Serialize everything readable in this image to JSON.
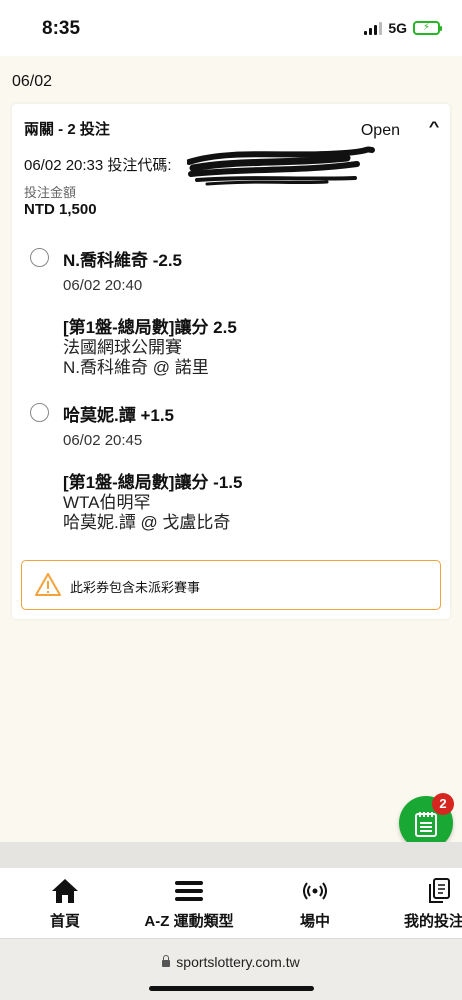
{
  "status_bar": {
    "time": "8:35",
    "network": "5G",
    "battery_color": "#29b326"
  },
  "date_heading": "06/02",
  "bet_card": {
    "title": "兩關 - 2 投注",
    "status": "Open",
    "bet_time_prefix": "06/02 20:33 投注代碼:",
    "amount_label": "投注金額",
    "amount_value": "NTD 1,500",
    "selections": [
      {
        "name": "N.喬科維奇 -2.5",
        "time": "06/02 20:40",
        "market": "[第1盤-總局數]讓分 2.5",
        "competition": "法國網球公開賽",
        "match": "N.喬科維奇 @ 諾里"
      },
      {
        "name": "哈莫妮.譚 +1.5",
        "time": "06/02 20:45",
        "market": "[第1盤-總局數]讓分 -1.5",
        "competition": "WTA伯明罕",
        "match": "哈莫妮.譚 @ 戈盧比奇"
      }
    ],
    "warning_text": "此彩券包含未派彩賽事",
    "warning_color": "#f0a23b"
  },
  "fab": {
    "badge_count": "2",
    "icon": "betslip-icon",
    "color": "#1aa834"
  },
  "bottom_nav": [
    {
      "label": "首頁",
      "icon": "home-icon"
    },
    {
      "label": "A-Z 運動類型",
      "icon": "menu-icon"
    },
    {
      "label": "場中",
      "icon": "live-icon"
    },
    {
      "label": "我的投注",
      "icon": "copy-icon"
    }
  ],
  "browser": {
    "url": "sportslottery.com.tw"
  }
}
